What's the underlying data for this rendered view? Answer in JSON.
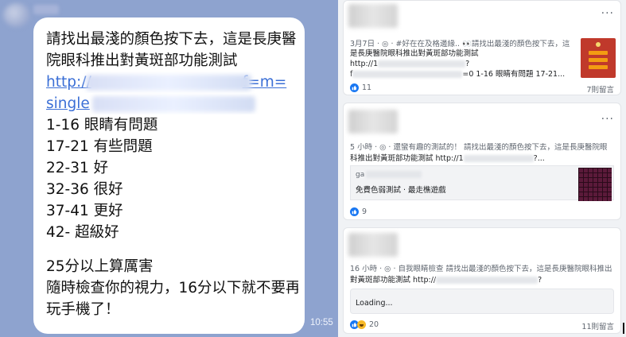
{
  "chat": {
    "lines": [
      "請找出最淺的顏色按下去，這是長庚醫",
      "院眼科推出對黃斑部功能測試"
    ],
    "link_line1": "http://",
    "link_line1_tail": "f=m=",
    "link_line2": "single",
    "scores": [
      "1-16 眼睛有問題",
      "17-21 有些問題",
      "22-31 好",
      "32-36 很好",
      "37-41 更好",
      "42- 超級好"
    ],
    "footer": [
      "25分以上算厲害",
      "隨時檢查你的視力，16分以下就不要再",
      "玩手機了！"
    ],
    "time": "10:55"
  },
  "feed": {
    "more_label": "···",
    "posts": [
      {
        "meta": "3月7日 · ◎ · #好在在及格邊緣.. 👀請找出最淺的顏色按下去，這",
        "line2": "是長庚醫院眼科推出對黃斑部功能測試",
        "line3": "http://1",
        "line3_tail": "?",
        "line4_start": "f",
        "line4_tail": "=0 1-16 眼睛有問題 17-21...",
        "reactions": "11",
        "comments": "7則留言"
      },
      {
        "meta": "5 小時 · ◎ · 還蠻有趣的測試的！ 請找出最淺的顏色按下去，這是長庚醫院眼",
        "line2": "科推出對黃斑部功能測試 http://1",
        "line2_tail": "?...",
        "link_domain": "ga",
        "link_title": "免費色弱測試 · 最走樵遊戲",
        "reactions": "9"
      },
      {
        "meta": "16 小時 · ◎ · 自我眼睛檢查 請找出最淺的顏色按下去，這是長庚醫院眼科推出",
        "line2": "對黃斑部功能測試 http://",
        "line2_tail": "?",
        "loading": "Loading...",
        "reactions": "20",
        "comments": "11則留言"
      }
    ]
  },
  "colors": {
    "chat_bg": "#8ea3cf",
    "link": "#3b6fd6",
    "like": "#1877f2",
    "feed_bg": "#f0f2f5"
  },
  "icons": [
    "like-icon",
    "haha-icon",
    "more-options-icon",
    "globe-icon"
  ]
}
